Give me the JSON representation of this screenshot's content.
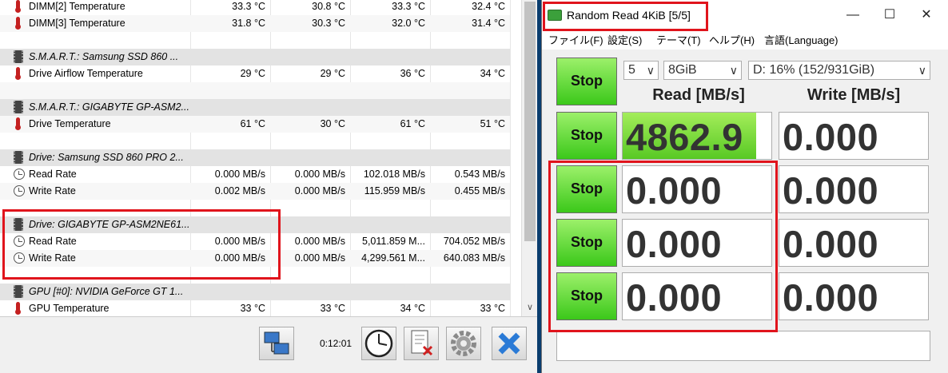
{
  "hwinfo": {
    "rows": [
      {
        "type": "therm",
        "label": "DIMM[2] Temperature",
        "v": [
          "33.3 °C",
          "30.8 °C",
          "33.3 °C",
          "32.4 °C"
        ]
      },
      {
        "type": "therm",
        "label": "DIMM[3] Temperature",
        "v": [
          "31.8 °C",
          "30.3 °C",
          "32.0 °C",
          "31.4 °C"
        ]
      },
      {
        "type": "blank"
      },
      {
        "type": "hdr",
        "label": "S.M.A.R.T.: Samsung SSD 860 ..."
      },
      {
        "type": "therm",
        "label": "Drive Airflow Temperature",
        "v": [
          "29 °C",
          "29 °C",
          "36 °C",
          "34 °C"
        ]
      },
      {
        "type": "blank"
      },
      {
        "type": "hdr",
        "label": "S.M.A.R.T.: GIGABYTE GP-ASM2..."
      },
      {
        "type": "therm",
        "label": "Drive Temperature",
        "v": [
          "61 °C",
          "30 °C",
          "61 °C",
          "51 °C"
        ]
      },
      {
        "type": "blank"
      },
      {
        "type": "hdr",
        "label": "Drive: Samsung SSD 860 PRO 2..."
      },
      {
        "type": "clock",
        "label": "Read Rate",
        "v": [
          "0.000 MB/s",
          "0.000 MB/s",
          "102.018 MB/s",
          "0.543 MB/s"
        ]
      },
      {
        "type": "clock",
        "label": "Write Rate",
        "v": [
          "0.002 MB/s",
          "0.000 MB/s",
          "115.959 MB/s",
          "0.455 MB/s"
        ]
      },
      {
        "type": "blank"
      },
      {
        "type": "hdr",
        "label": "Drive: GIGABYTE GP-ASM2NE61..."
      },
      {
        "type": "clock",
        "label": "Read Rate",
        "v": [
          "0.000 MB/s",
          "0.000 MB/s",
          "5,011.859 M...",
          "704.052 MB/s"
        ]
      },
      {
        "type": "clock",
        "label": "Write Rate",
        "v": [
          "0.000 MB/s",
          "0.000 MB/s",
          "4,299.561 M...",
          "640.083 MB/s"
        ]
      },
      {
        "type": "blank"
      },
      {
        "type": "hdr",
        "label": "GPU [#0]: NVIDIA GeForce GT 1..."
      },
      {
        "type": "therm",
        "label": "GPU Temperature",
        "v": [
          "33 °C",
          "33 °C",
          "34 °C",
          "33 °C"
        ]
      }
    ],
    "elapsed": "0:12:01",
    "scroll_down": "∨"
  },
  "cdm": {
    "title": "Random Read 4KiB [5/5]",
    "minimize": "—",
    "maximize": "☐",
    "close": "✕",
    "menu": [
      "ファイル(F)",
      "設定(S)",
      "テーマ(T)",
      "ヘルプ(H)",
      "言語(Language)"
    ],
    "count": "5",
    "size": "8GiB",
    "drive": "D: 16% (152/931GiB)",
    "read_header": "Read [MB/s]",
    "write_header": "Write [MB/s]",
    "stop_label": "Stop",
    "results": [
      {
        "read": "4862.9",
        "write": "0.000",
        "read_fill": 0.9
      },
      {
        "read": "0.000",
        "write": "0.000",
        "read_fill": 0
      },
      {
        "read": "0.000",
        "write": "0.000",
        "read_fill": 0
      },
      {
        "read": "0.000",
        "write": "0.000",
        "read_fill": 0
      }
    ]
  },
  "colors": {
    "highlight": "#e0141c",
    "stop_green": "#3bc81a"
  }
}
